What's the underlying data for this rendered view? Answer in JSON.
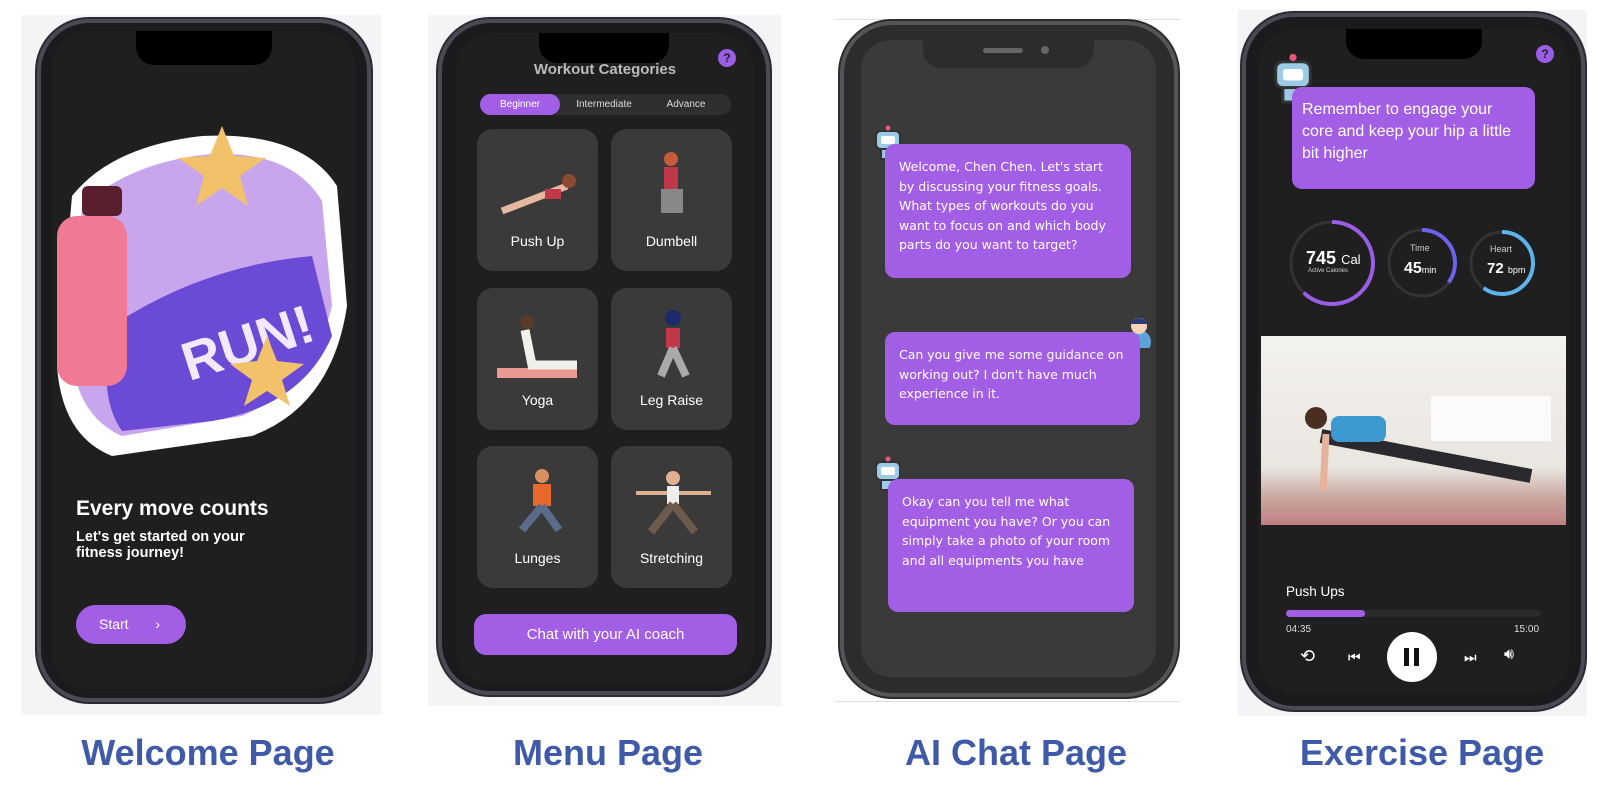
{
  "welcome": {
    "caption": "Welcome Page",
    "headline": "Every move counts",
    "subtitle": "Let's get started on your fitness journey!",
    "start_label": "Start",
    "illustration_text": "RUN!"
  },
  "menu": {
    "caption": "Menu Page",
    "title": "Workout Categories",
    "help": "?",
    "tabs": [
      {
        "label": "Beginner",
        "active": true
      },
      {
        "label": "Intermediate"
      },
      {
        "label": "Advance"
      }
    ],
    "cards": [
      {
        "label": "Push Up"
      },
      {
        "label": "Dumbell"
      },
      {
        "label": "Yoga"
      },
      {
        "label": "Leg Raise"
      },
      {
        "label": "Lunges"
      },
      {
        "label": "Stretching"
      }
    ],
    "chat_button": "Chat with your AI coach"
  },
  "chat": {
    "caption": "AI Chat Page",
    "messages": [
      {
        "sender": "ai",
        "text": "Welcome, Chen Chen. Let's start by discussing your fitness goals. What types of workouts do you want to focus on and which body parts do you want to target?"
      },
      {
        "sender": "user",
        "text": "Can you give me some guidance on working out? I don't have much experience in it."
      },
      {
        "sender": "ai",
        "text": "Okay can you tell me what equipment you have? Or you can simply take a photo of your room and all equipments you have"
      }
    ]
  },
  "exercise": {
    "caption": "Exercise Page",
    "help": "?",
    "coach_message": "Remember to engage your core and keep your hip a little bit higher",
    "calories": {
      "value": "745",
      "unit": "Cal",
      "label": "Active Calories",
      "progress": 0.62
    },
    "time": {
      "label": "Time",
      "value": "45",
      "unit": "min",
      "progress": 0.35
    },
    "heart": {
      "label": "Heart",
      "value": "72",
      "unit": "bpm",
      "progress": 0.6
    },
    "exercise_name": "Push Ups",
    "elapsed": "04:35",
    "total": "15:00",
    "progress": 0.31
  },
  "colors": {
    "accent": "#a35ee6",
    "caption": "#3f5aa8"
  }
}
